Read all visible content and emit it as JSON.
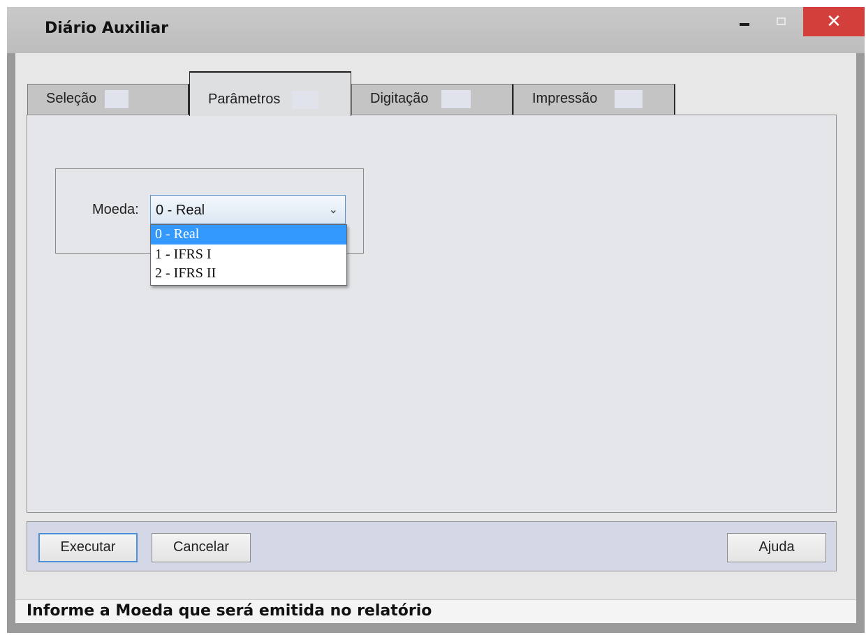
{
  "window": {
    "title": "Diário Auxiliar",
    "close_glyph": "✕"
  },
  "tabs": [
    {
      "label": "Seleção"
    },
    {
      "label": "Parâmetros"
    },
    {
      "label": "Digitação"
    },
    {
      "label": "Impressão"
    }
  ],
  "active_tab": "Parâmetros",
  "params": {
    "moeda_label": "Moeda:",
    "moeda_selected": "0 - Real",
    "moeda_options": [
      "0 - Real",
      "1 - IFRS I",
      "2 - IFRS II"
    ],
    "chevron_glyph": "⌄"
  },
  "buttons": {
    "executar": "Executar",
    "cancelar": "Cancelar",
    "ajuda": "Ajuda"
  },
  "status": {
    "message": "Informe a Moeda que será emitida no relatório"
  },
  "colors": {
    "close_button": "#d3403c",
    "dropdown_highlight": "#3399ff",
    "focus_border": "#4d8fd8"
  },
  "icons": [
    "minimize-icon",
    "maximize-icon",
    "close-icon",
    "chevron-down-icon"
  ]
}
